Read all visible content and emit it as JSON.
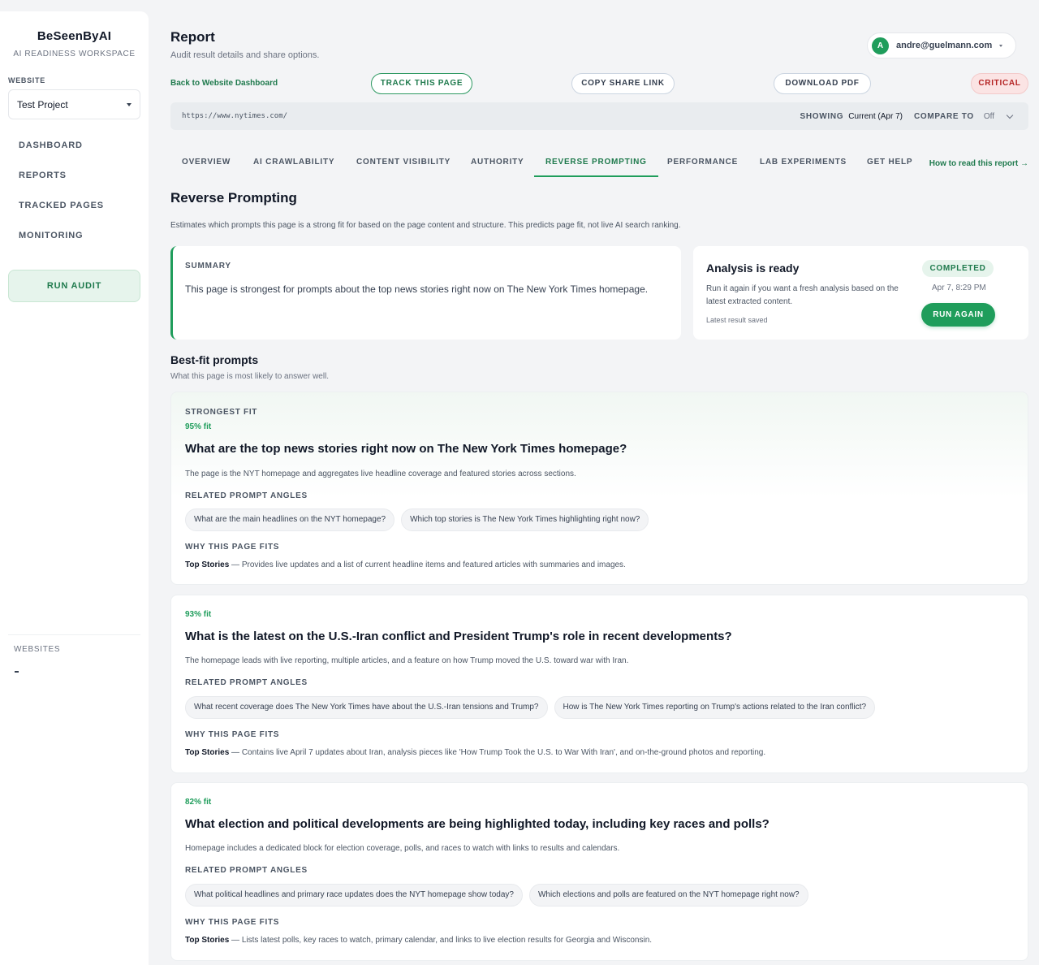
{
  "sidebar": {
    "brand": "BeSeenByAI",
    "brand_sub": "AI READINESS WORKSPACE",
    "website_label": "WEBSITE",
    "project": "Test Project",
    "nav": [
      "DASHBOARD",
      "REPORTS",
      "TRACKED PAGES",
      "MONITORING"
    ],
    "run_audit": "RUN AUDIT",
    "websites_label": "WEBSITES"
  },
  "header": {
    "title": "Report",
    "subtitle": "Audit result details and share options.",
    "user_initial": "A",
    "user_email": "andre@guelmann.com",
    "back_link": "Back to Website Dashboard",
    "track_label": "TRACK THIS PAGE",
    "copy_label": "COPY SHARE LINK",
    "pdf_label": "DOWNLOAD PDF",
    "severity": "CRITICAL"
  },
  "url_bar": {
    "url": "https://www.nytimes.com/",
    "showing_label": "SHOWING",
    "showing_value": "Current (Apr 7)",
    "compare_label": "COMPARE TO",
    "compare_value": "Off"
  },
  "tabs": [
    "OVERVIEW",
    "AI CRAWLABILITY",
    "CONTENT VISIBILITY",
    "AUTHORITY",
    "REVERSE PROMPTING",
    "PERFORMANCE",
    "LAB EXPERIMENTS",
    "GET HELP"
  ],
  "active_tab": "REVERSE PROMPTING",
  "how_link": "How to read this report →",
  "section": {
    "title": "Reverse Prompting",
    "desc": "Estimates which prompts this page is a strong fit for based on the page content and structure. This predicts page fit, not live AI search ranking."
  },
  "summary": {
    "label": "SUMMARY",
    "text": "This page is strongest for prompts about the top news stories right now on The New York Times homepage."
  },
  "status": {
    "title": "Analysis is ready",
    "body": "Run it again if you want a fresh analysis based on the latest extracted content.",
    "saved": "Latest result saved",
    "badge": "COMPLETED",
    "time": "Apr 7, 8:29 PM",
    "run_again": "RUN AGAIN"
  },
  "best_fit": {
    "title": "Best-fit prompts",
    "subtitle": "What this page is most likely to answer well.",
    "related_label": "RELATED PROMPT ANGLES",
    "why_label": "WHY THIS PAGE FITS",
    "prompts": [
      {
        "eyebrow": "STRONGEST FIT",
        "fit": "95% fit",
        "question": "What are the top news stories right now on The New York Times homepage?",
        "desc": "The page is the NYT homepage and aggregates live headline coverage and featured stories across sections.",
        "chip1": "What are the main headlines on the NYT homepage?",
        "chip2": "Which top stories is The New York Times highlighting right now?",
        "why_section": "Top Stories",
        "why_text": " — Provides live updates and a list of current headline items and featured articles with summaries and images."
      },
      {
        "fit": "93% fit",
        "question": "What is the latest on the U.S.-Iran conflict and President Trump's role in recent developments?",
        "desc": "The homepage leads with live reporting, multiple articles, and a feature on how Trump moved the U.S. toward war with Iran.",
        "chip1": "What recent coverage does The New York Times have about the U.S.-Iran tensions and Trump?",
        "chip2": "How is The New York Times reporting on Trump's actions related to the Iran conflict?",
        "why_section": "Top Stories",
        "why_text": " — Contains live April 7 updates about Iran, analysis pieces like 'How Trump Took the U.S. to War With Iran', and on-the-ground photos and reporting."
      },
      {
        "fit": "82% fit",
        "question": "What election and political developments are being highlighted today, including key races and polls?",
        "desc": "Homepage includes a dedicated block for election coverage, polls, and races to watch with links to results and calendars.",
        "chip1": "What political headlines and primary race updates does the NYT homepage show today?",
        "chip2": "Which elections and polls are featured on the NYT homepage right now?",
        "why_section": "Top Stories",
        "why_text": " — Lists latest polls, key races to watch, primary calendar, and links to live election results for Georgia and Wisconsin."
      }
    ]
  }
}
